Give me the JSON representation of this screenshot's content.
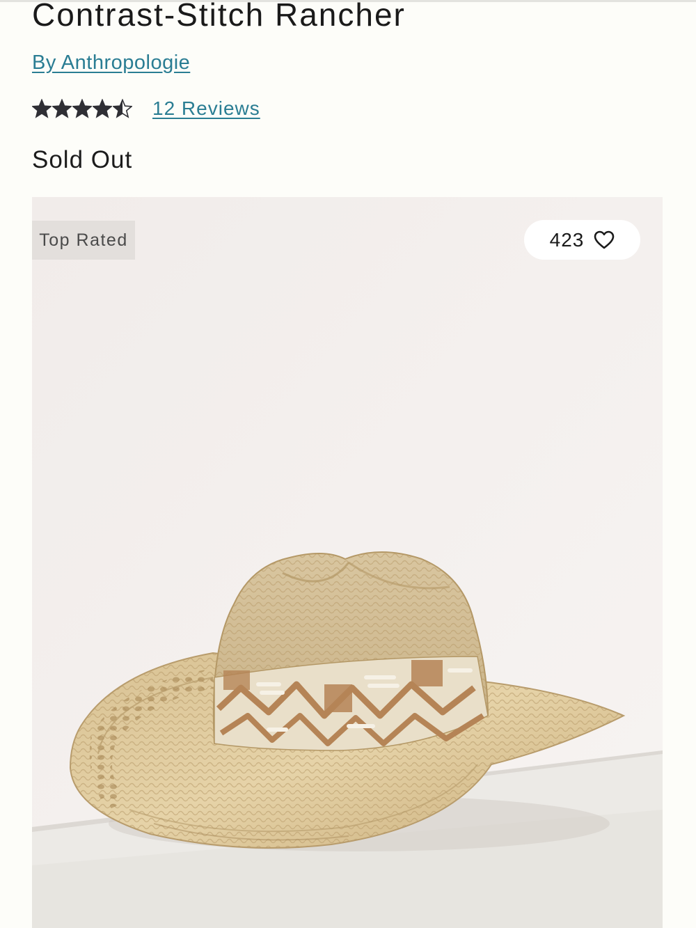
{
  "product": {
    "title": "Contrast-Stitch Rancher",
    "brand_link": "By Anthropologie",
    "rating": {
      "value": 4.5,
      "max": 5,
      "reviews_label": "12 Reviews"
    },
    "stock_status": "Sold Out"
  },
  "image": {
    "badge": "Top Rated",
    "favorites_count": "423",
    "favorite_icon": "heart-outline-icon",
    "subject": "straw rancher hat"
  },
  "colors": {
    "link": "#2a7d93",
    "star": "#2f2f35",
    "badge_bg": "#e3dfdc",
    "image_bg": "#f4f0ee"
  }
}
